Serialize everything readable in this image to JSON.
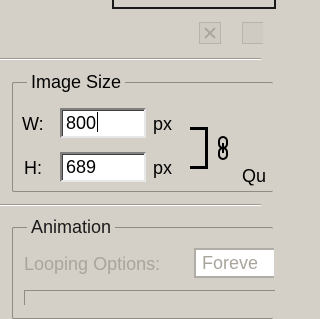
{
  "image_size": {
    "legend": "Image Size",
    "width_label": "W:",
    "width_value": "800",
    "width_unit": "px",
    "height_label": "H:",
    "height_value": "689",
    "height_unit": "px",
    "cut_label": "Qu"
  },
  "animation": {
    "legend": "Animation",
    "looping_label": "Looping Options:",
    "looping_value": "Foreve"
  },
  "colors": {
    "panel_bg": "#d4d0c8",
    "disabled_text": "#a9a59d"
  },
  "icons": {
    "top_button_1": "close-x-icon",
    "link": "chain-link-icon"
  }
}
